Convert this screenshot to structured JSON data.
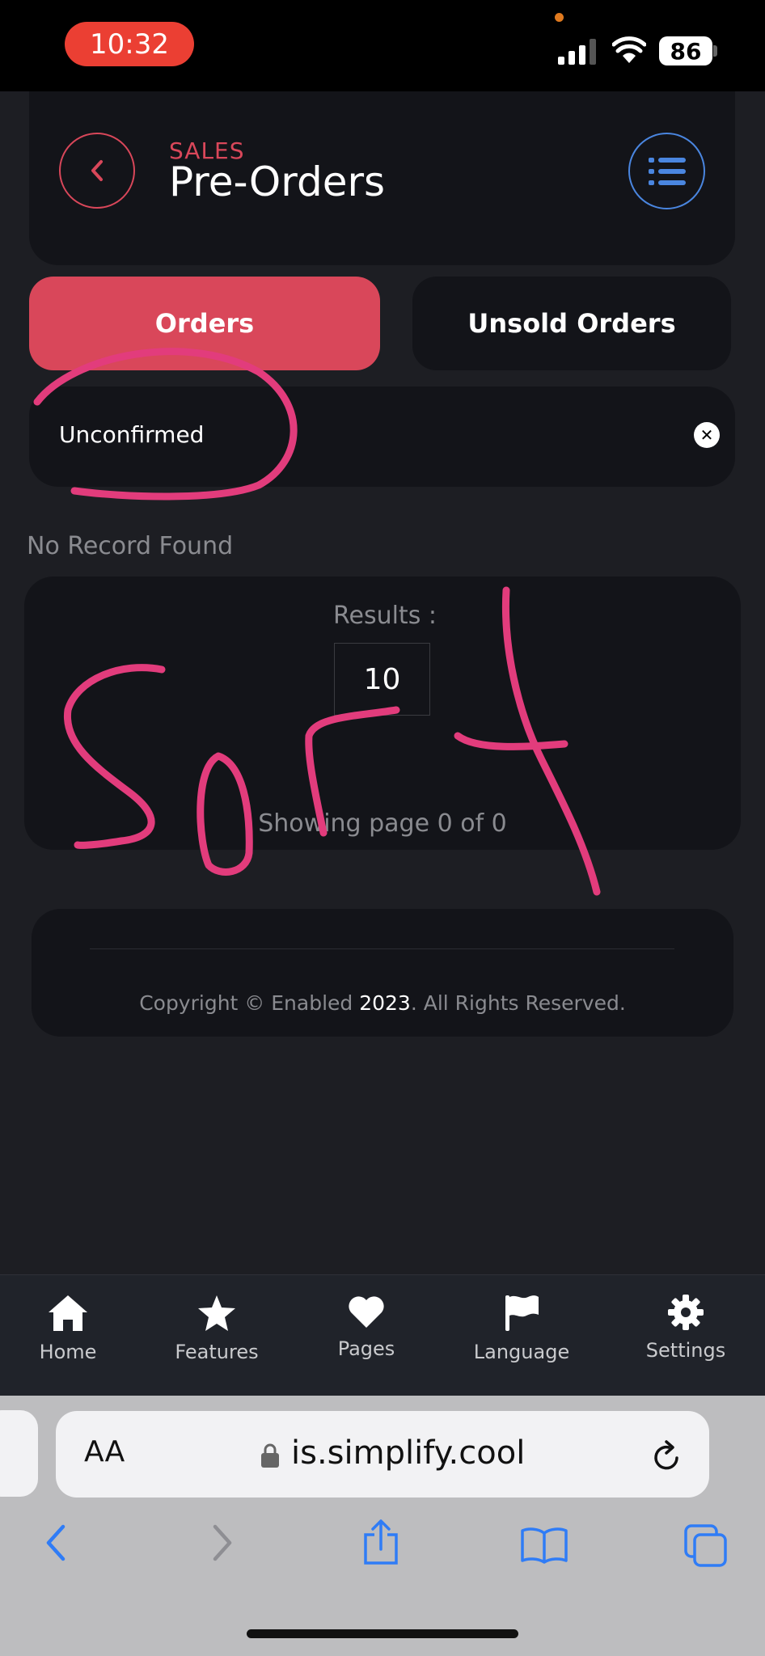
{
  "status_bar": {
    "time": "10:32",
    "battery": "86"
  },
  "header": {
    "section": "SALES",
    "title": "Pre-Orders"
  },
  "tabs": [
    {
      "label": "Orders",
      "active": true
    },
    {
      "label": "Unsold Orders",
      "active": false
    }
  ],
  "filter": {
    "value": "Unconfirmed"
  },
  "main": {
    "empty_message": "No Record Found",
    "results_label": "Results :",
    "results_per_page": "10",
    "paging_text": "Showing page 0 of 0"
  },
  "footer": {
    "copyright_prefix": "Copyright © Enabled ",
    "year": "2023",
    "copyright_suffix": ". All Rights Reserved."
  },
  "bottom_nav": [
    {
      "label": "Home",
      "icon": "home-icon"
    },
    {
      "label": "Features",
      "icon": "star-icon"
    },
    {
      "label": "Pages",
      "icon": "heart-icon"
    },
    {
      "label": "Language",
      "icon": "flag-icon"
    },
    {
      "label": "Settings",
      "icon": "gear-icon"
    }
  ],
  "browser": {
    "text_size_button": "AA",
    "url": "is.simplify.cool"
  },
  "annotation": {
    "handwritten_text": "Sort"
  },
  "colors": {
    "accent": "#d9475a",
    "menu_accent": "#4a86e0",
    "scribble": "#e23c7c",
    "background": "#1d1e23",
    "card": "#131419"
  }
}
